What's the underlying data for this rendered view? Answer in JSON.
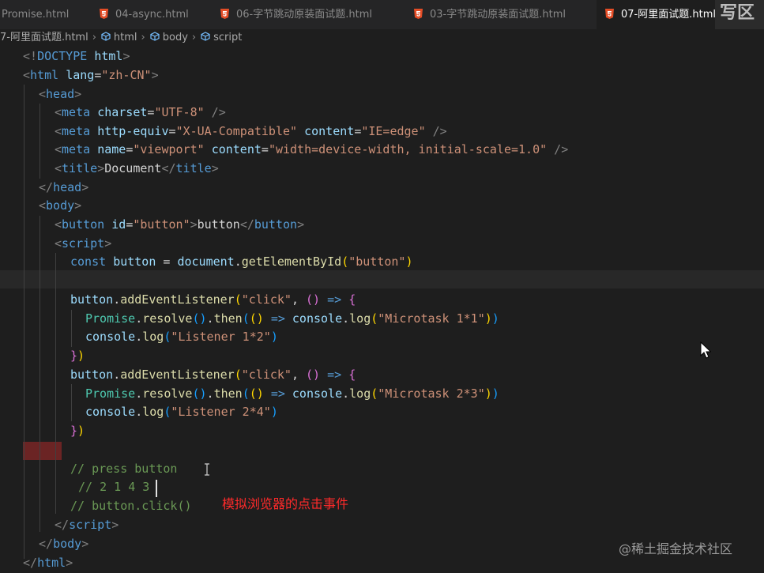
{
  "tabs": [
    {
      "label": "Promise.html",
      "icon": "html5-icon"
    },
    {
      "label": "04-async.html",
      "icon": "html5-icon"
    },
    {
      "label": "06-字节跳动原装面试题.html",
      "icon": "html5-icon"
    },
    {
      "label": "03-字节跳动原装面试题.html",
      "icon": "html5-icon"
    },
    {
      "label": "07-阿里面试题.html",
      "icon": "html5-icon",
      "active": true
    }
  ],
  "corner_text": "写区",
  "breadcrumb": {
    "file": "7-阿里面试题.html",
    "items": [
      "html",
      "body",
      "script"
    ]
  },
  "code": {
    "l1": {
      "open": "<!",
      "tag": "DOCTYPE",
      "attr": "html",
      "close": ">"
    },
    "l2": {
      "open": "<",
      "tag": "html",
      "attr": "lang",
      "eq": "=",
      "val": "\"zh-CN\"",
      "close": ">"
    },
    "l3": {
      "open": "<",
      "tag": "head",
      "close": ">"
    },
    "l4": {
      "open": "<",
      "tag": "meta",
      "attr": "charset",
      "eq": "=",
      "val": "\"UTF-8\"",
      "close": " />"
    },
    "l5": {
      "open": "<",
      "tag": "meta",
      "attr1": "http-equiv",
      "eq1": "=",
      "val1": "\"X-UA-Compatible\"",
      "attr2": "content",
      "eq2": "=",
      "val2": "\"IE=edge\"",
      "close": " />"
    },
    "l6": {
      "open": "<",
      "tag": "meta",
      "attr1": "name",
      "eq1": "=",
      "val1": "\"viewport\"",
      "attr2": "content",
      "eq2": "=",
      "val2": "\"width=device-width, initial-scale=1.0\"",
      "close": " />"
    },
    "l7": {
      "open": "<",
      "tag": "title",
      "mid": ">",
      "text": "Document",
      "open2": "</",
      "tag2": "title",
      "close": ">"
    },
    "l8": {
      "open": "</",
      "tag": "head",
      "close": ">"
    },
    "l9": {
      "open": "<",
      "tag": "body",
      "close": ">"
    },
    "l10": {
      "open": "<",
      "tag": "button",
      "attr": "id",
      "eq": "=",
      "val": "\"button\"",
      "mid": ">",
      "text": "button",
      "open2": "</",
      "tag2": "button",
      "close": ">"
    },
    "l11": {
      "open": "<",
      "tag": "script",
      "close": ">"
    },
    "l12": {
      "kw": "const",
      "var": "button",
      "op": "=",
      "obj": "document",
      "dot": ".",
      "fn": "getElementById",
      "lp": "(",
      "str": "\"button\"",
      "rp": ")"
    },
    "l13": {
      "obj": "button",
      "dot": ".",
      "fn": "addEventListener",
      "lp": "(",
      "str": "\"click\"",
      "comma": ",",
      "lp2": "()",
      "arrow": "=>",
      "brace": "{"
    },
    "l14": {
      "obj": "Promise",
      "dot": ".",
      "fn": "resolve",
      "pp": "()",
      "dot2": ".",
      "fn2": "then",
      "lp": "(",
      "lp2": "()",
      "arrow": "=>",
      "obj2": "console",
      "dot3": ".",
      "fn3": "log",
      "lp3": "(",
      "str": "\"Microtask 1*1\"",
      "rp3": ")",
      "rp": ")"
    },
    "l15": {
      "obj": "console",
      "dot": ".",
      "fn": "log",
      "lp": "(",
      "str": "\"Listener 1*2\"",
      "rp": ")"
    },
    "l16": {
      "brace": "}",
      "rp": ")"
    },
    "l17": {
      "obj": "button",
      "dot": ".",
      "fn": "addEventListener",
      "lp": "(",
      "str": "\"click\"",
      "comma": ",",
      "lp2": "()",
      "arrow": "=>",
      "brace": "{"
    },
    "l18": {
      "obj": "Promise",
      "dot": ".",
      "fn": "resolve",
      "pp": "()",
      "dot2": ".",
      "fn2": "then",
      "lp": "(",
      "lp2": "()",
      "arrow": "=>",
      "obj2": "console",
      "dot3": ".",
      "fn3": "log",
      "lp3": "(",
      "str": "\"Microtask 2*3\"",
      "rp3": ")",
      "rp": ")"
    },
    "l19": {
      "obj": "console",
      "dot": ".",
      "fn": "log",
      "lp": "(",
      "str": "\"Listener 2*4\"",
      "rp": ")"
    },
    "l20": {
      "brace": "}",
      "rp": ")"
    },
    "l21": {
      "comment": "// press button"
    },
    "l22": {
      "comment": "// 2 1 4 3"
    },
    "l23": {
      "comment": "// button.click()"
    },
    "l24": {
      "open": "</",
      "tag": "script",
      "close": ">"
    },
    "l25": {
      "open": "</",
      "tag": "body",
      "close": ">"
    },
    "l26": {
      "open": "</",
      "tag": "html",
      "close": ">"
    }
  },
  "annotation": "模拟浏览器的点击事件",
  "watermark": "@稀土掘金技术社区",
  "colors": {
    "tag": "#569cd6",
    "attr": "#9cdcfe",
    "string": "#ce9178",
    "function": "#dcdcaa",
    "comment": "#6a9955",
    "annotation": "#ff2a2a",
    "html5": "#e44d26"
  }
}
